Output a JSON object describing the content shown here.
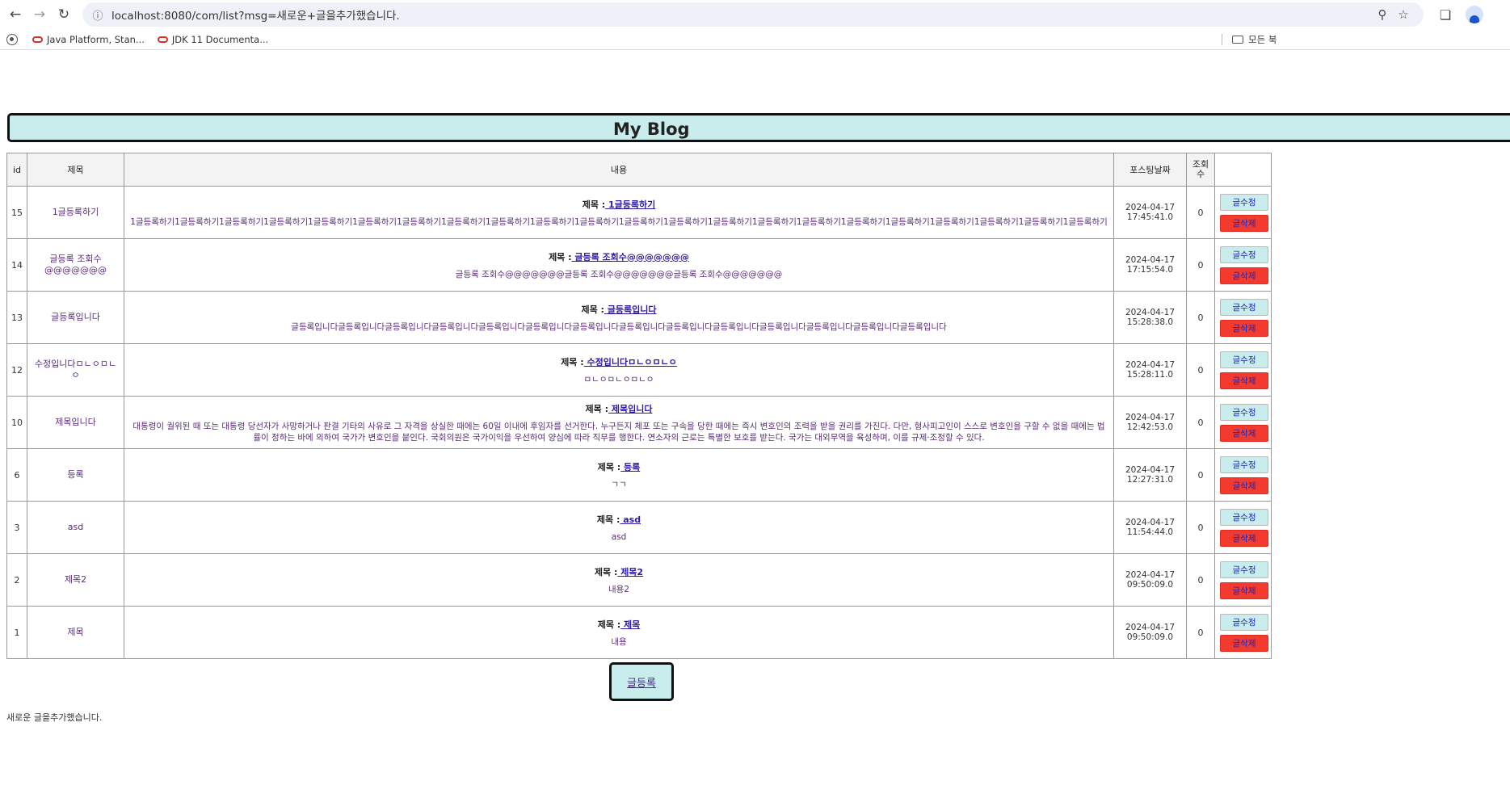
{
  "browser": {
    "url": "localhost:8080/com/list?msg=새로운+글을추가했습니다.",
    "bookmarks": [
      {
        "label": "Java Platform, Stan..."
      },
      {
        "label": "JDK 11 Documenta..."
      }
    ],
    "all_bookmarks_label": "모든 북"
  },
  "page": {
    "title": "My Blog",
    "columns": {
      "id": "id",
      "title": "제목",
      "content": "내용",
      "date": "포스팅날짜",
      "views": "조회수"
    },
    "content_title_prefix": "제목 :",
    "edit_label": "글수정",
    "delete_label": "글삭제",
    "write_label": "글등록",
    "footer_message": "새로운 글을추가했습니다.",
    "posts": [
      {
        "id": "15",
        "title": "1글등록하기",
        "content_title": " 1글등록하기",
        "content": "1글등록하기1글등록하기1글등록하기1글등록하기1글등록하기1글등록하기1글등록하기1글등록하기1글등록하기1글등록하기1글등록하기1글등록하기1글등록하기1글등록하기1글등록하기1글등록하기1글등록하기1글등록하기1글등록하기1글등록하기1글등록하기1글등록하기",
        "date": "2024-04-17",
        "time": "17:45:41.0",
        "views": "0"
      },
      {
        "id": "14",
        "title": "글등록 조회수@@@@@@@",
        "content_title": " 글등록 조회수@@@@@@@",
        "content": "글등록 조회수@@@@@@@글등록 조회수@@@@@@@글등록 조회수@@@@@@@",
        "date": "2024-04-17",
        "time": "17:15:54.0",
        "views": "0"
      },
      {
        "id": "13",
        "title": "글등록입니다",
        "content_title": " 글등록입니다",
        "content": "글등록입니다글등록입니다글등록입니다글등록입니다글등록입니다글등록입니다글등록입니다글등록입니다글등록입니다글등록입니다글등록입니다글등록입니다글등록입니다글등록입니다",
        "date": "2024-04-17",
        "time": "15:28:38.0",
        "views": "0"
      },
      {
        "id": "12",
        "title": "수정입니다ㅁㄴㅇㅁㄴㅇ",
        "content_title": " 수정입니다ㅁㄴㅇㅁㄴㅇ",
        "content": "ㅁㄴㅇㅁㄴㅇㅁㄴㅇ",
        "date": "2024-04-17",
        "time": "15:28:11.0",
        "views": "0"
      },
      {
        "id": "10",
        "title": "제목입니다",
        "content_title": " 제목입니다",
        "content": "대통령이 궐위된 때 또는 대통령 당선자가 사망하거나 판결 기타의 사유로 그 자격을 상실한 때에는 60일 이내에 후임자를 선거한다. 누구든지 체포 또는 구속을 당한 때에는 즉시 변호인의 조력을 받을 권리를 가진다. 다만, 형사피고인이 스스로 변호인을 구할 수 없을 때에는 법률이 정하는 바에 의하여 국가가 변호인을 붙인다. 국회의원은 국가이익을 우선하여 양심에 따라 직무를 행한다. 연소자의 근로는 특별한 보호를 받는다. 국가는 대외무역을 육성하며, 이를 규제·조정할 수 있다.",
        "date": "2024-04-17",
        "time": "12:42:53.0",
        "views": "0"
      },
      {
        "id": "6",
        "title": "등록",
        "content_title": " 등록",
        "content": "ㄱㄱ",
        "date": "2024-04-17",
        "time": "12:27:31.0",
        "views": "0"
      },
      {
        "id": "3",
        "title": "asd",
        "content_title": " asd",
        "content": "asd",
        "date": "2024-04-17",
        "time": "11:54:44.0",
        "views": "0"
      },
      {
        "id": "2",
        "title": "제목2",
        "content_title": " 제목2",
        "content": "내용2",
        "date": "2024-04-17",
        "time": "09:50:09.0",
        "views": "0"
      },
      {
        "id": "1",
        "title": "제목",
        "content_title": " 제목",
        "content": "내용",
        "date": "2024-04-17",
        "time": "09:50:09.0",
        "views": "0"
      }
    ]
  }
}
